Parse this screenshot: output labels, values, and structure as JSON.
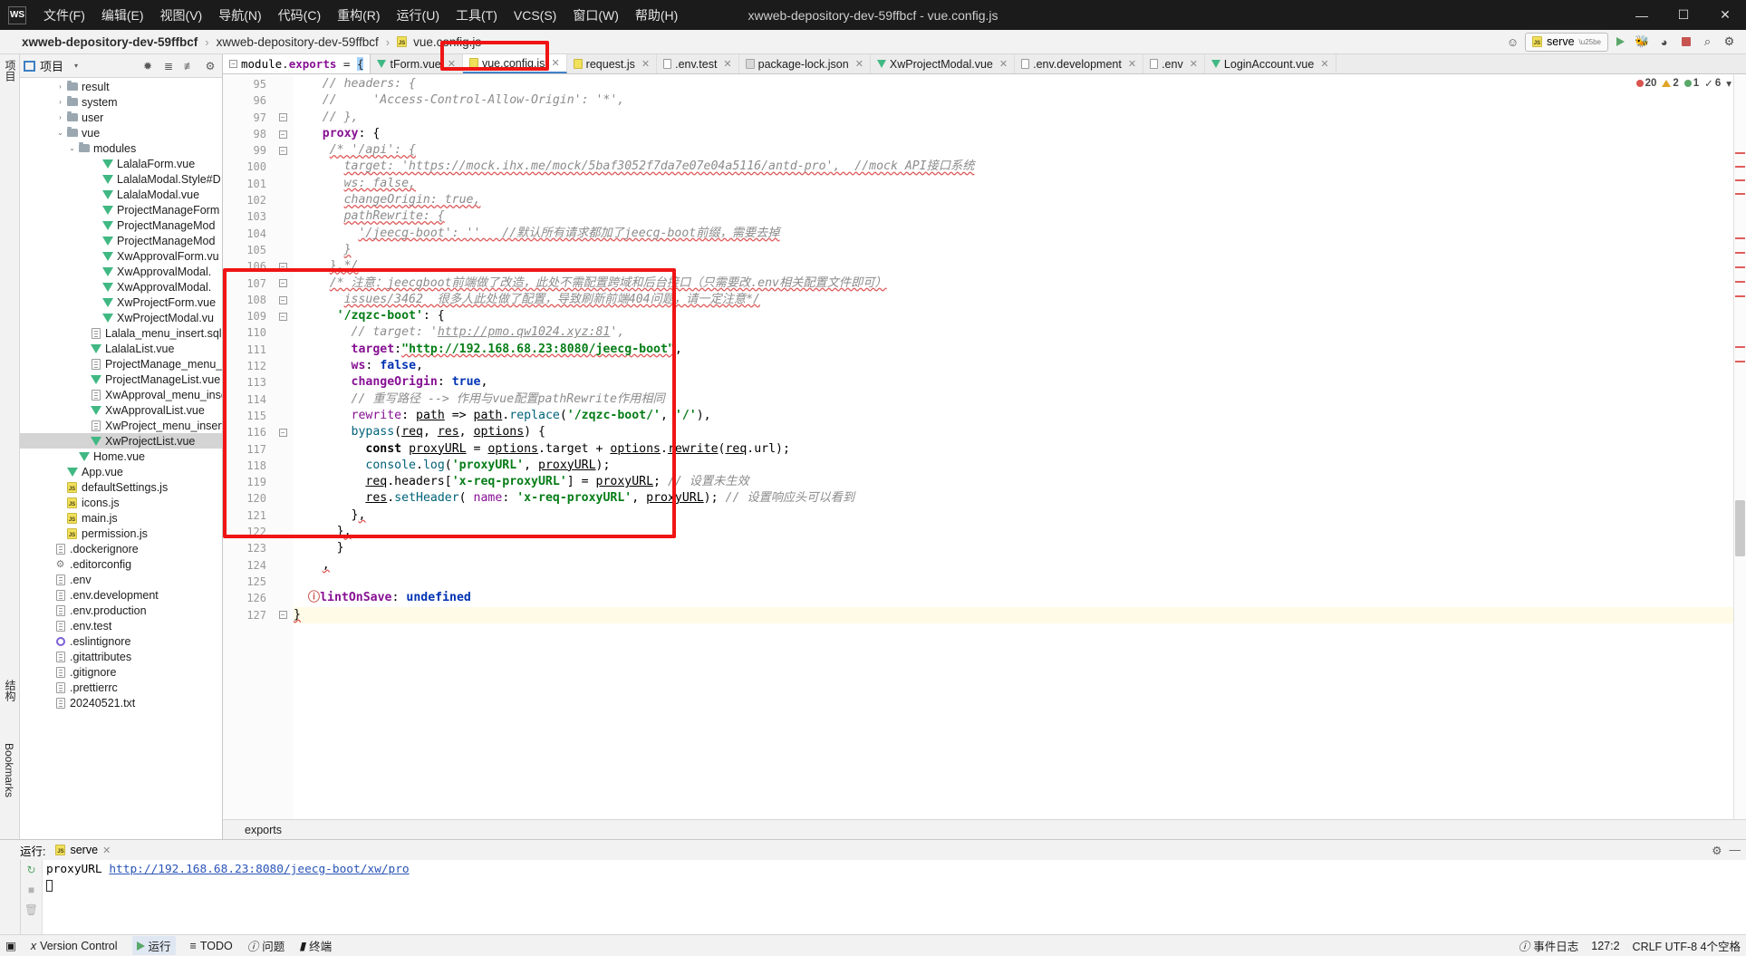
{
  "window": {
    "title": "xwweb-depository-dev-59ffbcf - vue.config.js",
    "logo": "WS",
    "minimize": "—",
    "maximize": "☐",
    "close": "✕"
  },
  "menu": [
    {
      "label": "文件(F)",
      "name": "menu-file"
    },
    {
      "label": "编辑(E)",
      "name": "menu-edit"
    },
    {
      "label": "视图(V)",
      "name": "menu-view"
    },
    {
      "label": "导航(N)",
      "name": "menu-navigate"
    },
    {
      "label": "代码(C)",
      "name": "menu-code"
    },
    {
      "label": "重构(R)",
      "name": "menu-refactor"
    },
    {
      "label": "运行(U)",
      "name": "menu-run"
    },
    {
      "label": "工具(T)",
      "name": "menu-tools"
    },
    {
      "label": "VCS(S)",
      "name": "menu-vcs"
    },
    {
      "label": "窗口(W)",
      "name": "menu-window"
    },
    {
      "label": "帮助(H)",
      "name": "menu-help"
    }
  ],
  "breadcrumb": {
    "project": "xwweb-depository-dev-59ffbcf",
    "module": "xwweb-depository-dev-59ffbcf",
    "file": "vue.config.js",
    "sep": "›"
  },
  "navbar_right": {
    "run_config": "serve",
    "search_icon": "⌕",
    "settings_icon": "⚙",
    "user_icon": "☺"
  },
  "rails": {
    "left_top": "项目",
    "left_structure": "结构",
    "left_bookmarks": "Bookmarks"
  },
  "tree": {
    "title": "项目",
    "items": [
      {
        "label": "result",
        "indent": 3,
        "icon": "folder",
        "arrow": "›",
        "selected": false
      },
      {
        "label": "system",
        "indent": 3,
        "icon": "folder",
        "arrow": "›",
        "selected": false
      },
      {
        "label": "user",
        "indent": 3,
        "icon": "folder",
        "arrow": "›",
        "selected": false
      },
      {
        "label": "vue",
        "indent": 3,
        "icon": "folder",
        "arrow": "⌄",
        "selected": false
      },
      {
        "label": "modules",
        "indent": 4,
        "icon": "folder",
        "arrow": "⌄",
        "selected": false
      },
      {
        "label": "LalalaForm.vue",
        "indent": 6,
        "icon": "vue",
        "arrow": "",
        "selected": false
      },
      {
        "label": "LalalaModal.Style#D",
        "indent": 6,
        "icon": "vue",
        "arrow": "",
        "selected": false
      },
      {
        "label": "LalalaModal.vue",
        "indent": 6,
        "icon": "vue",
        "arrow": "",
        "selected": false
      },
      {
        "label": "ProjectManageForm",
        "indent": 6,
        "icon": "vue",
        "arrow": "",
        "selected": false
      },
      {
        "label": "ProjectManageMod",
        "indent": 6,
        "icon": "vue",
        "arrow": "",
        "selected": false
      },
      {
        "label": "ProjectManageMod",
        "indent": 6,
        "icon": "vue",
        "arrow": "",
        "selected": false
      },
      {
        "label": "XwApprovalForm.vu",
        "indent": 6,
        "icon": "vue",
        "arrow": "",
        "selected": false
      },
      {
        "label": "XwApprovalModal.",
        "indent": 6,
        "icon": "vue",
        "arrow": "",
        "selected": false
      },
      {
        "label": "XwApprovalModal.",
        "indent": 6,
        "icon": "vue",
        "arrow": "",
        "selected": false
      },
      {
        "label": "XwProjectForm.vue",
        "indent": 6,
        "icon": "vue",
        "arrow": "",
        "selected": false
      },
      {
        "label": "XwProjectModal.vu",
        "indent": 6,
        "icon": "vue",
        "arrow": "",
        "selected": false
      },
      {
        "label": "Lalala_menu_insert.sql",
        "indent": 5,
        "icon": "txt",
        "arrow": "",
        "selected": false
      },
      {
        "label": "LalalaList.vue",
        "indent": 5,
        "icon": "vue",
        "arrow": "",
        "selected": false
      },
      {
        "label": "ProjectManage_menu_i",
        "indent": 5,
        "icon": "txt",
        "arrow": "",
        "selected": false
      },
      {
        "label": "ProjectManageList.vue",
        "indent": 5,
        "icon": "vue",
        "arrow": "",
        "selected": false
      },
      {
        "label": "XwApproval_menu_inse",
        "indent": 5,
        "icon": "txt",
        "arrow": "",
        "selected": false
      },
      {
        "label": "XwApprovalList.vue",
        "indent": 5,
        "icon": "vue",
        "arrow": "",
        "selected": false
      },
      {
        "label": "XwProject_menu_insert.",
        "indent": 5,
        "icon": "txt",
        "arrow": "",
        "selected": false
      },
      {
        "label": "XwProjectList.vue",
        "indent": 5,
        "icon": "vue",
        "arrow": "",
        "selected": true
      },
      {
        "label": "Home.vue",
        "indent": 4,
        "icon": "vue",
        "arrow": "",
        "selected": false
      },
      {
        "label": "App.vue",
        "indent": 3,
        "icon": "vue",
        "arrow": "",
        "selected": false
      },
      {
        "label": "defaultSettings.js",
        "indent": 3,
        "icon": "js",
        "arrow": "",
        "selected": false
      },
      {
        "label": "icons.js",
        "indent": 3,
        "icon": "js",
        "arrow": "",
        "selected": false
      },
      {
        "label": "main.js",
        "indent": 3,
        "icon": "js",
        "arrow": "",
        "selected": false
      },
      {
        "label": "permission.js",
        "indent": 3,
        "icon": "js",
        "arrow": "",
        "selected": false
      },
      {
        "label": ".dockerignore",
        "indent": 2,
        "icon": "txt",
        "arrow": "",
        "selected": false
      },
      {
        "label": ".editorconfig",
        "indent": 2,
        "icon": "gear",
        "arrow": "",
        "selected": false
      },
      {
        "label": ".env",
        "indent": 2,
        "icon": "txt",
        "arrow": "",
        "selected": false
      },
      {
        "label": ".env.development",
        "indent": 2,
        "icon": "txt",
        "arrow": "",
        "selected": false
      },
      {
        "label": ".env.production",
        "indent": 2,
        "icon": "txt",
        "arrow": "",
        "selected": false
      },
      {
        "label": ".env.test",
        "indent": 2,
        "icon": "txt",
        "arrow": "",
        "selected": false
      },
      {
        "label": ".eslintignore",
        "indent": 2,
        "icon": "circ",
        "arrow": "",
        "selected": false
      },
      {
        "label": ".gitattributes",
        "indent": 2,
        "icon": "txt",
        "arrow": "",
        "selected": false
      },
      {
        "label": ".gitignore",
        "indent": 2,
        "icon": "txt",
        "arrow": "",
        "selected": false
      },
      {
        "label": ".prettierrc",
        "indent": 2,
        "icon": "txt",
        "arrow": "",
        "selected": false
      },
      {
        "label": "20240521.txt",
        "indent": 2,
        "icon": "txt",
        "arrow": "",
        "selected": false
      }
    ]
  },
  "tabs": [
    {
      "label": "tForm.vue",
      "icon": "vue",
      "active": false
    },
    {
      "label": "vue.config.js",
      "icon": "js",
      "active": true
    },
    {
      "label": "request.js",
      "icon": "js",
      "active": false
    },
    {
      "label": ".env.test",
      "icon": "doc",
      "active": false
    },
    {
      "label": "package-lock.json",
      "icon": "json",
      "active": false
    },
    {
      "label": "XwProjectModal.vue",
      "icon": "vue",
      "active": false
    },
    {
      "label": ".env.development",
      "icon": "doc",
      "active": false
    },
    {
      "label": ".env",
      "icon": "doc",
      "active": false
    },
    {
      "label": "LoginAccount.vue",
      "icon": "vue",
      "active": false
    }
  ],
  "editor": {
    "pinned_line": "module.exports = {",
    "first_line_number": 95,
    "lines": [
      {
        "n": 95,
        "fold": "",
        "html": "    <span class=\"cmt\">// headers: {</span>"
      },
      {
        "n": 96,
        "fold": "",
        "html": "    <span class=\"cmt\">//     'Access-Control-Allow-Origin': '*',</span>"
      },
      {
        "n": 97,
        "fold": "m",
        "html": "    <span class=\"cmt\">// },</span>"
      },
      {
        "n": 98,
        "fold": "p",
        "html": "    <span class=\"prop\">proxy</span>: {"
      },
      {
        "n": 99,
        "fold": "p",
        "html": "     <span class=\"cmt wav\">/* '/api': {</span>"
      },
      {
        "n": 100,
        "fold": "",
        "html": "       <span class=\"cmt wav\">target: 'https://mock.ihx.me/mock/5baf3052f7da7e07e04a5116/antd-pro',  //mock API接口系统</span>"
      },
      {
        "n": 101,
        "fold": "",
        "html": "       <span class=\"cmt wav\">ws: false,</span>"
      },
      {
        "n": 102,
        "fold": "",
        "html": "       <span class=\"cmt wav\">changeOrigin: true,</span>"
      },
      {
        "n": 103,
        "fold": "",
        "html": "       <span class=\"cmt wav\">pathRewrite: {</span>"
      },
      {
        "n": 104,
        "fold": "",
        "html": "         <span class=\"cmt wav\">'/jeecg-boot': ''   //默认所有请求都加了jeecg-boot前缀，需要去掉</span>"
      },
      {
        "n": 105,
        "fold": "",
        "html": "       <span class=\"cmt wav\">}</span>"
      },
      {
        "n": 106,
        "fold": "m",
        "html": "     <span class=\"cmt wav\">},*/</span>"
      },
      {
        "n": 107,
        "fold": "p",
        "html": "     <span class=\"cmt wav\">/* 注意：jeecgboot前端做了改造，此处不需配置跨域和后台接口（只需要改.env相关配置文件即可）</span>"
      },
      {
        "n": 108,
        "fold": "m",
        "html": "       <span class=\"cmt wav\">issues/3462  很多人此处做了配置，导致刷新前端404问题，请一定注意*/</span>"
      },
      {
        "n": 109,
        "fold": "p",
        "html": "      <span class=\"str\">'/zqzc-boot'</span>: {"
      },
      {
        "n": 110,
        "fold": "",
        "html": "        <span class=\"cmt\">// target: '<u>http://pmo.qw1024.xyz:81</u>',</span>"
      },
      {
        "n": 111,
        "fold": "",
        "html": "        <span class=\"prop\">target</span>:<span class=\"str wav\">\"http://192.168.68.23:8080/jeecg-boot\"</span>,"
      },
      {
        "n": 112,
        "fold": "",
        "html": "        <span class=\"prop\">ws</span>: <span class=\"bool\">false</span>,"
      },
      {
        "n": 113,
        "fold": "",
        "html": "        <span class=\"prop\">changeOrigin</span>: <span class=\"bool\">true</span>,"
      },
      {
        "n": 114,
        "fold": "",
        "html": "        <span class=\"cmt\">// 重写路径 --&gt; 作用与vue配置pathRewrite作用相同</span>"
      },
      {
        "n": 115,
        "fold": "",
        "html": "        <span class=\"prop2\">rewrite</span>: <span class=\"uline\">path</span> =&gt; <span class=\"uline\">path</span>.<span class=\"fn\">replace</span>(<span class=\"str\">'/zqzc-boot/'</span>, <span class=\"str\">'/'</span>),"
      },
      {
        "n": 116,
        "fold": "p",
        "html": "        <span class=\"fn\">bypass</span>(<span class=\"uline\">req</span>, <span class=\"uline\">res</span>, <span class=\"uline\">options</span>) {"
      },
      {
        "n": 117,
        "fold": "",
        "html": "          <span class=\"kw\">const</span> <span class=\"uline\">proxyURL</span> = <span class=\"uline\">options</span>.target + <span class=\"uline\">options</span>.<span class=\"uline\">rewrite</span>(<span class=\"uline\">req</span>.url);"
      },
      {
        "n": 118,
        "fold": "",
        "html": "          <span class=\"fn\">console</span>.<span class=\"fn\">log</span>(<span class=\"str\">'proxyURL'</span>, <span class=\"uline\">proxyURL</span>);"
      },
      {
        "n": 119,
        "fold": "",
        "html": "          <span class=\"uline\">req</span>.headers[<span class=\"str\">'x-req-proxyURL'</span>] = <span class=\"uline\">proxyURL</span>; <span class=\"cmt\">// 设置未生效</span>"
      },
      {
        "n": 120,
        "fold": "",
        "html": "          <span class=\"uline\">res</span>.<span class=\"fn\">setHeader</span>( <span class=\"prop2\">name</span>: <span class=\"str\">'x-req-proxyURL'</span>, <span class=\"uline\">proxyURL</span>); <span class=\"cmt\">// 设置响应头可以看到</span>"
      },
      {
        "n": 121,
        "fold": "",
        "html": "        }<span class=\"wav\">,</span>"
      },
      {
        "n": 122,
        "fold": "",
        "html": "      }<span class=\"wav\">,</span>"
      },
      {
        "n": 123,
        "fold": "",
        "html": "      }"
      },
      {
        "n": 124,
        "fold": "",
        "html": "    <span class=\"wav\">,</span>"
      },
      {
        "n": 125,
        "fold": "",
        "html": ""
      },
      {
        "n": 126,
        "fold": "",
        "html": "  <span class=\"err-dot\">ⓘ</span><span class=\"prop\">lintOnSave</span>: <span class=\"bool\">undefined</span>"
      },
      {
        "n": 127,
        "fold": "m",
        "html": "<span class=\"wav\">}</span>"
      }
    ],
    "status_hint": "exports",
    "inspections": {
      "errors": "20",
      "warnings": "2",
      "weak": "1",
      "ok": "6"
    }
  },
  "run_console": {
    "label": "运行:",
    "tab": "serve",
    "close": "✕",
    "output_prefix": "proxyURL ",
    "output_link": "http://192.168.68.23:8080/jeecg-boot/xw/pro",
    "settings_icon": "⚙",
    "hide_icon": "—"
  },
  "statusbar": {
    "items": [
      {
        "label": "Version Control",
        "icon": "branch-icon",
        "name": "status-version-control"
      },
      {
        "label": "运行",
        "icon": "run-icon",
        "name": "status-run"
      },
      {
        "label": "TODO",
        "icon": "list-icon",
        "name": "status-todo"
      },
      {
        "label": "问题",
        "icon": "info-icon",
        "name": "status-problems"
      },
      {
        "label": "终端",
        "icon": "terminal-icon",
        "name": "status-terminal"
      }
    ],
    "right": {
      "event_log": "事件日志",
      "caret": "127:2",
      "encoding": "CRLF  UTF-8  4个空格"
    }
  }
}
